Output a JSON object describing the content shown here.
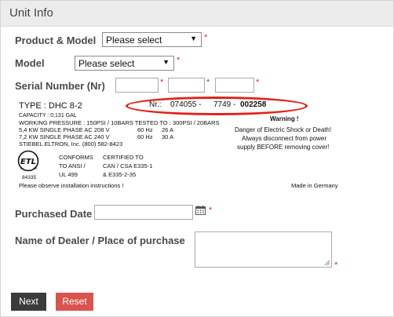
{
  "panel": {
    "title": "Unit Info"
  },
  "form": {
    "product_model": {
      "label": "Product & Model",
      "value": "Please select"
    },
    "model": {
      "label": "Model",
      "value": "Please select"
    },
    "serial": {
      "label": "Serial Number (Nr)"
    },
    "purchased": {
      "label": "Purchased Date"
    },
    "dealer": {
      "label": "Name of Dealer / Place of purchase"
    },
    "required_mark": "*"
  },
  "plate": {
    "type_line": "TYPE :  DHC 8-2",
    "nr_prefix": "Nr.:",
    "nr_part1": "074055 -",
    "nr_part2": "7749",
    "nr_dash": "-",
    "nr_part3": "002258",
    "capacity": "CAPACITY : 0,131 GAL",
    "pressure": "WORKING PRESSURE : 150PSI / 10BARS     TESTED TO : 300PSI / 20BARS",
    "spec1_power": "5,4 KW  SINGLE PHASE  AC  208 V",
    "spec1_hz": "60 Hz",
    "spec1_amp": "26 A",
    "spec2_power": "7,2 KW  SINGLE PHASE  AC  240 V",
    "spec2_hz": "60 Hz",
    "spec2_amp": "30 A",
    "company": "STIEBEL ELTRON, Inc.  (800) 582-8423",
    "warning_title": "Warning !",
    "warning_1": "Danger of Electric Shock or Death!",
    "warning_2": "Always disconnect from power",
    "warning_3": "supply BEFORE removing cover!",
    "conforms_1": "CONFORMS",
    "conforms_2": "TO ANSI /",
    "conforms_3": "UL 499",
    "certified_1": "CERTIFIED TO",
    "certified_2": "CAN / CSA E335-1",
    "certified_3": "& E335-2-35",
    "logo_number": "84335",
    "instructions": "Please observe installation instructions !",
    "made_in": "Made in Germany"
  },
  "buttons": {
    "next": "Next",
    "reset": "Reset"
  },
  "colors": {
    "required": "#d9302a",
    "ellipse": "#e0231d",
    "next_bg": "#3b3b3b",
    "reset_bg": "#d9534f"
  },
  "icons": {
    "calendar": "calendar-icon",
    "select_caret": "triangle-down",
    "resize": "resize-grip-icon"
  }
}
